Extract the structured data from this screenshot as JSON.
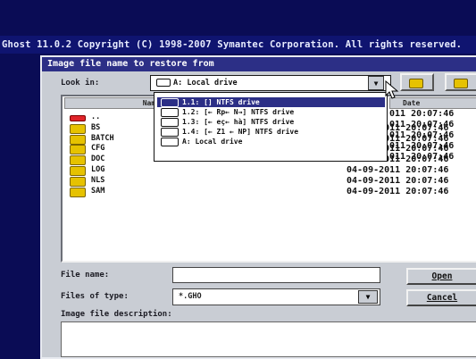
{
  "app": {
    "title_bar": "Ghost 11.0.2   Copyright (C) 1998-2007 Symantec Corporation. All rights reserved."
  },
  "dialog": {
    "title": "Image file name to restore from",
    "look_in_label": "Look in:",
    "look_in_value": "A: Local drive",
    "columns": {
      "name": "Name",
      "date": "Date"
    },
    "dropdown_items": [
      {
        "label": "1.1: [] NTFS drive",
        "selected": true
      },
      {
        "label": "1.2: [← Rp← N→] NTFS drive",
        "selected": false
      },
      {
        "label": "1.3: [← eç← hà] NTFS drive",
        "selected": false
      },
      {
        "label": "1.4: [← Z1 ← NP] NTFS drive",
        "selected": false
      },
      {
        "label": "A: Local drive",
        "selected": false
      }
    ],
    "files": [
      {
        "name": "..",
        "date": ""
      },
      {
        "name": "BS",
        "date": "04-09-2011 20:07:46"
      },
      {
        "name": "BATCH",
        "date": "04-09-2011 20:07:46"
      },
      {
        "name": "CFG",
        "date": "04-09-2011 20:07:46"
      },
      {
        "name": "DOC",
        "date": "04-09-2011 20:07:46"
      },
      {
        "name": "LOG",
        "date": "04-09-2011 20:07:46"
      },
      {
        "name": "NLS",
        "date": "04-09-2011 20:07:46"
      },
      {
        "name": "SAM",
        "date": "04-09-2011 20:07:46"
      }
    ],
    "top_date_partial": "011 20:07:46",
    "file_name_label": "File name:",
    "file_name_value": "",
    "files_of_type_label": "Files of type:",
    "files_of_type_value": "*.GHO",
    "description_label": "Image file description:",
    "open_button": "Open",
    "cancel_button": "Cancel"
  }
}
